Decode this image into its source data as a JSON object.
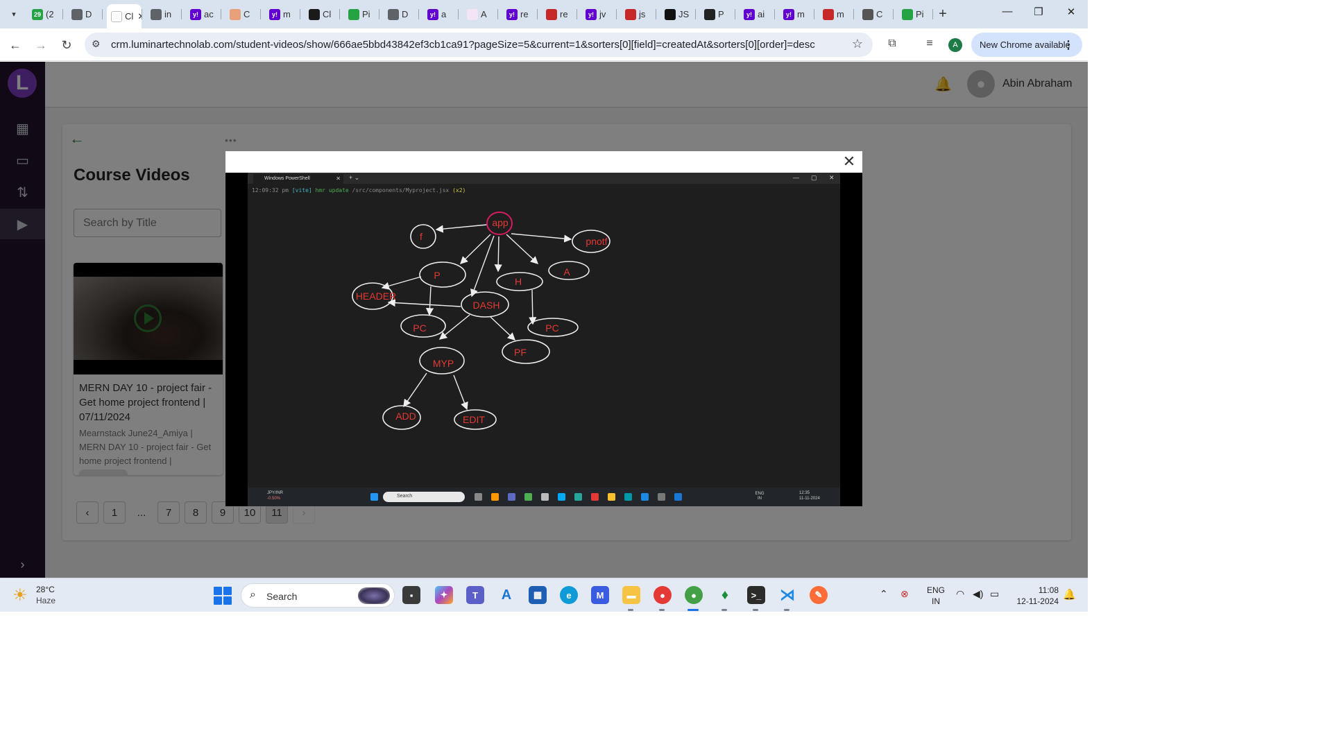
{
  "browser": {
    "tabs": [
      {
        "label": "(2",
        "fav_color": "#25a244",
        "fav_text": "29"
      },
      {
        "label": "D",
        "fav_color": "#5f6368",
        "fav_text": ""
      },
      {
        "label": "Cl",
        "fav_color": "#ffffff",
        "fav_text": "",
        "active": true
      },
      {
        "label": "in",
        "fav_color": "#5f6368",
        "fav_text": ""
      },
      {
        "label": "ac",
        "fav_color": "#6001d2",
        "fav_text": "y!"
      },
      {
        "label": "C",
        "fav_color": "#e8a07a",
        "fav_text": ""
      },
      {
        "label": "m",
        "fav_color": "#6001d2",
        "fav_text": "y!"
      },
      {
        "label": "Cl",
        "fav_color": "#1a1a1a",
        "fav_text": ""
      },
      {
        "label": "Pi",
        "fav_color": "#25a244",
        "fav_text": ""
      },
      {
        "label": "D",
        "fav_color": "#5f6368",
        "fav_text": ""
      },
      {
        "label": "a",
        "fav_color": "#6001d2",
        "fav_text": "y!"
      },
      {
        "label": "A",
        "fav_color": "#f3e5f5",
        "fav_text": ""
      },
      {
        "label": "re",
        "fav_color": "#6001d2",
        "fav_text": "y!"
      },
      {
        "label": "re",
        "fav_color": "#c62828",
        "fav_text": ""
      },
      {
        "label": "jv",
        "fav_color": "#6001d2",
        "fav_text": "y!"
      },
      {
        "label": "js",
        "fav_color": "#c62828",
        "fav_text": ""
      },
      {
        "label": "JS",
        "fav_color": "#111111",
        "fav_text": ""
      },
      {
        "label": "P",
        "fav_color": "#222222",
        "fav_text": ""
      },
      {
        "label": "ai",
        "fav_color": "#6001d2",
        "fav_text": "y!"
      },
      {
        "label": "m",
        "fav_color": "#6001d2",
        "fav_text": "y!"
      },
      {
        "label": "m",
        "fav_color": "#c62828",
        "fav_text": ""
      },
      {
        "label": "C",
        "fav_color": "#555555",
        "fav_text": ""
      },
      {
        "label": "Pi",
        "fav_color": "#25a244",
        "fav_text": ""
      }
    ],
    "url": "crm.luminartechnolab.com/student-videos/show/666ae5bbd43842ef3cb1ca91?pageSize=5&current=1&sorters[0][field]=createdAt&sorters[0][order]=desc",
    "profile_initial": "A",
    "update_label": "New Chrome available"
  },
  "app": {
    "logo_letter": "L",
    "user_name": "Abin Abraham",
    "page_title": "Course Videos",
    "search_placeholder": "Search by Title",
    "video_card": {
      "title": "MERN DAY 10 - project fair - Get home project frontend | 07/11/2024",
      "description": "Mearnstack June24_Amiya | MERN DAY 10 - project fair - Get home project frontend | 07/11/2024"
    },
    "pagination": [
      "1",
      "...",
      "7",
      "8",
      "9",
      "10",
      "11"
    ],
    "current_page": "11"
  },
  "video_frame": {
    "terminal_tab": "Windows PowerShell",
    "terminal_line": {
      "time": "12:09:32 pm",
      "tag": "[vite]",
      "action": "hmr update",
      "path": "/src/components/Myproject.jsx",
      "count": "(x2)"
    },
    "nodes": [
      "app",
      "f",
      "pnotf",
      "P",
      "H",
      "A",
      "HEADER",
      "DASH",
      "PC",
      "PC",
      "PF",
      "MYP",
      "ADD",
      "EDIT"
    ],
    "taskbar": {
      "ticker": "JPY/INR",
      "ticker_change": "-0.50%",
      "search": "Search",
      "lang": "ENG IN",
      "time": "12:35",
      "date": "11-11-2024"
    }
  },
  "os_taskbar": {
    "temperature": "28°C",
    "weather": "Haze",
    "search_label": "Search",
    "lang_line1": "ENG",
    "lang_line2": "IN",
    "time": "11:08",
    "date": "12-11-2024"
  }
}
